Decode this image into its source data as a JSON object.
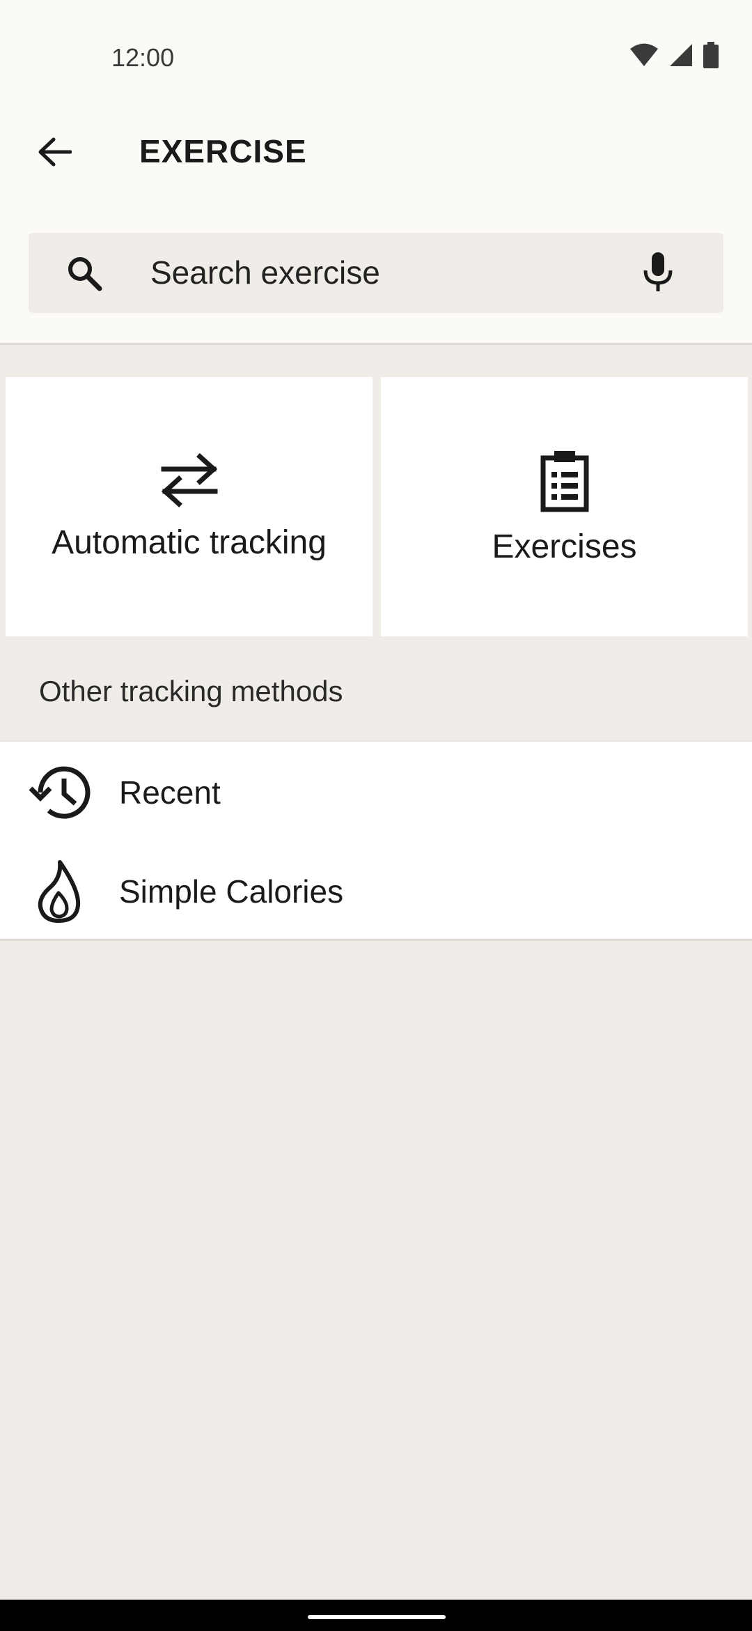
{
  "status_bar": {
    "time": "12:00",
    "icons": [
      "wifi-icon",
      "cellular-signal-icon",
      "battery-icon"
    ]
  },
  "app_bar": {
    "back_icon": "arrow-left-icon",
    "title": "EXERCISE"
  },
  "search": {
    "placeholder": "Search exercise",
    "value": "",
    "leading_icon": "search-icon",
    "trailing_icon": "microphone-icon"
  },
  "tiles": [
    {
      "label": "Automatic tracking",
      "icon": "swap-arrows-icon"
    },
    {
      "label": "Exercises",
      "icon": "clipboard-list-icon"
    }
  ],
  "other_methods": {
    "header": "Other tracking methods",
    "items": [
      {
        "label": "Recent",
        "icon": "history-icon"
      },
      {
        "label": "Simple Calories",
        "icon": "flame-icon"
      }
    ]
  },
  "colors": {
    "background": "#f0ede8",
    "surface": "#ffffff",
    "top_area": "#fbfaf6",
    "text": "#1a1a1a",
    "nav_bar": "#000000"
  }
}
